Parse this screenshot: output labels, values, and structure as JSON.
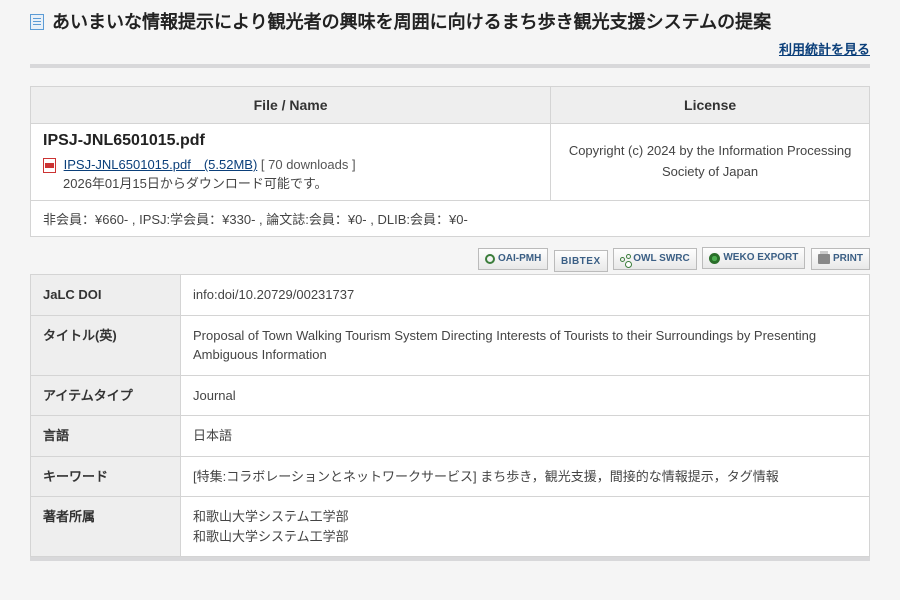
{
  "title": "あいまいな情報提示により観光者の興味を周囲に向けるまち歩き観光支援システムの提案",
  "stats_link": "利用統計を見る",
  "file_table": {
    "headers": {
      "file": "File / Name",
      "license": "License"
    },
    "filename": "IPSJ-JNL6501015.pdf",
    "file_link_label": "IPSJ-JNL6501015.pdf　(5.52MB)",
    "downloads": "[ 70 downloads ]",
    "dl_note": "2026年01月15日からダウンロード可能です。",
    "license_text": "Copyright (c) 2024 by the Information Processing Society of Japan",
    "price_row": "非会員：¥660- , IPSJ:学会員：¥330- , 論文誌:会員：¥0- , DLIB:会員：¥0-"
  },
  "export_buttons": {
    "oai": "OAI-PMH",
    "bibtex": "BIBTEX",
    "owl": "OWL SWRC",
    "weko": "WEKO EXPORT",
    "print": "PRINT"
  },
  "metadata": {
    "rows": [
      {
        "label": "JaLC DOI",
        "value": "info:doi/10.20729/00231737"
      },
      {
        "label": "タイトル(英)",
        "value": "Proposal of Town Walking Tourism System Directing Interests of Tourists to their Surroundings by Presenting Ambiguous Information"
      },
      {
        "label": "アイテムタイプ",
        "value": "Journal"
      },
      {
        "label": "言語",
        "value": "日本語"
      },
      {
        "label": "キーワード",
        "value": "[特集:コラボレーションとネットワークサービス] まち歩き，観光支援，間接的な情報提示，タグ情報"
      },
      {
        "label": "著者所属",
        "value": "和歌山大学システム工学部\n和歌山大学システム工学部"
      }
    ]
  }
}
